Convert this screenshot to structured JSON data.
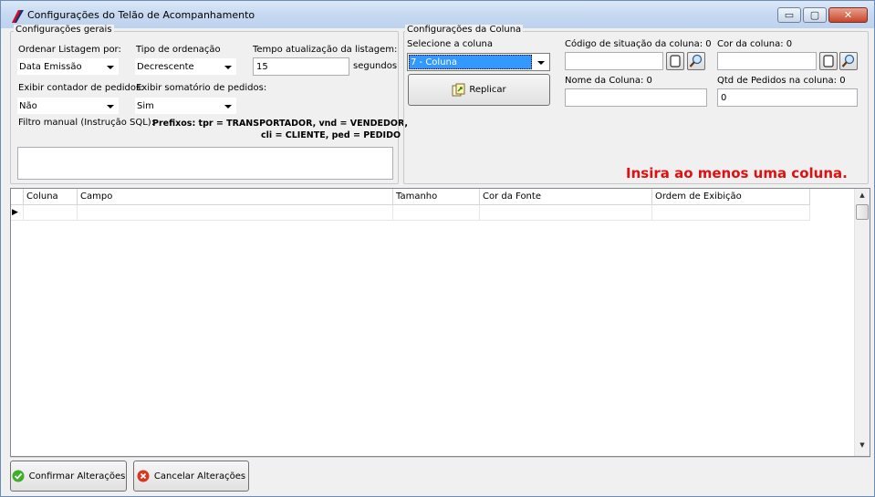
{
  "window": {
    "title": "Configurações do Telão de Acompanhamento",
    "min_glyph": "▭",
    "max_glyph": "▢",
    "close_glyph": "✕"
  },
  "general": {
    "group_title": "Configurações gerais",
    "order_list_label": "Ordenar Listagem por:",
    "order_list_value": "Data Emissão",
    "order_type_label": "Tipo de ordenação",
    "order_type_value": "Decrescente",
    "refresh_label": "Tempo atualização da listagem:",
    "refresh_value": "15",
    "refresh_unit": "segundos",
    "show_counter_label": "Exibir contador de pedidos:",
    "show_counter_value": "Não",
    "show_sum_label": "Exibir somatório de pedidos:",
    "show_sum_value": "Sim",
    "filter_label": "Filtro manual (Instrução SQL):",
    "prefixes_line1": "Prefixos: tpr =  TRANSPORTADOR, vnd = VENDEDOR,",
    "prefixes_line2": "cli = CLIENTE, ped = PEDIDO",
    "filter_value": ""
  },
  "column": {
    "group_title": "Configurações da Coluna",
    "select_label": "Selecione a coluna",
    "select_value": "7 - Coluna",
    "replicate_label": "Replicar",
    "status_code_label": "Código de situação da  coluna: 0",
    "status_code_value": "",
    "color_label": "Cor da coluna: 0",
    "color_value": "",
    "name_label": "Nome da Coluna: 0",
    "name_value": "",
    "qty_label": "Qtd de Pedidos na coluna: 0",
    "qty_value": "0",
    "warning": "Insira ao menos uma coluna."
  },
  "grid": {
    "columns": [
      "Coluna",
      "Campo",
      "Tamanho",
      "Cor da Fonte",
      "Ordem de Exibição"
    ],
    "row_indicator": "▶"
  },
  "footer": {
    "confirm_label": "Confirmar Alterações",
    "cancel_label": "Cancelar Alterações"
  },
  "colors": {
    "warning": "#e01010",
    "selection": "#3399ff",
    "confirm_icon": "#3fae2a",
    "cancel_icon": "#d9381e"
  }
}
